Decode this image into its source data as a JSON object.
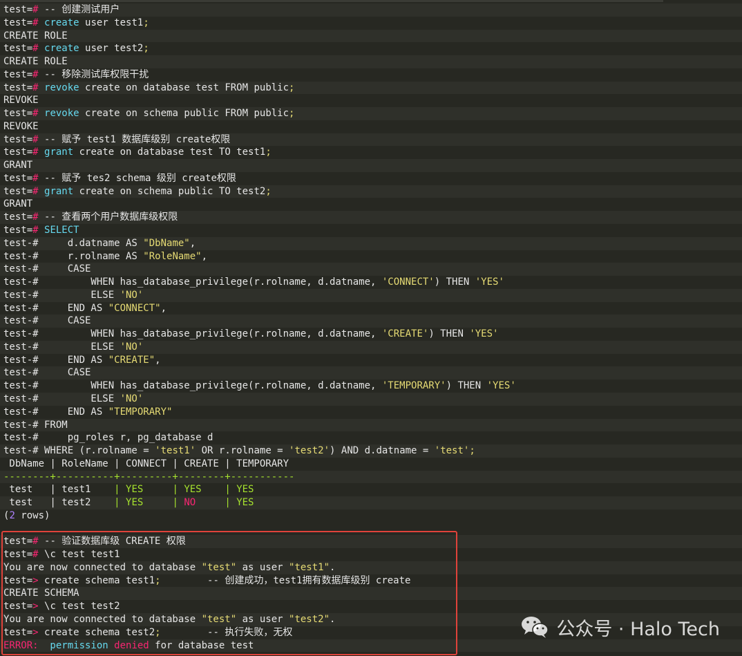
{
  "colors": {
    "background": "#272822",
    "text": "#e6e6e6",
    "prompt": "#e6e6e6",
    "hash": "#f92672",
    "keyword": "#66d9ef",
    "string": "#e6db74",
    "yes": "#a6e22e",
    "no": "#f92672",
    "separator": "#a6e22e",
    "rows_count": "#ae81ff",
    "error": "#f92672",
    "highlight_border": "#e0433b"
  },
  "lines": [
    {
      "stripe": true,
      "segs": [
        {
          "t": "test=",
          "c": "prompt"
        },
        {
          "t": "#",
          "c": "hash"
        },
        {
          "t": " -- 创建测试用户",
          "c": "text"
        }
      ]
    },
    {
      "stripe": false,
      "segs": [
        {
          "t": "test=",
          "c": "prompt"
        },
        {
          "t": "#",
          "c": "hash"
        },
        {
          "t": " create",
          "c": "keyword"
        },
        {
          "t": " user test1",
          "c": "text"
        },
        {
          "t": ";",
          "c": "string"
        }
      ]
    },
    {
      "stripe": true,
      "segs": [
        {
          "t": "CREATE ROLE",
          "c": "text"
        }
      ]
    },
    {
      "stripe": false,
      "segs": [
        {
          "t": "test=",
          "c": "prompt"
        },
        {
          "t": "#",
          "c": "hash"
        },
        {
          "t": " create",
          "c": "keyword"
        },
        {
          "t": " user test2",
          "c": "text"
        },
        {
          "t": ";",
          "c": "string"
        }
      ]
    },
    {
      "stripe": true,
      "segs": [
        {
          "t": "CREATE ROLE",
          "c": "text"
        }
      ]
    },
    {
      "stripe": false,
      "segs": [
        {
          "t": "test=",
          "c": "prompt"
        },
        {
          "t": "#",
          "c": "hash"
        },
        {
          "t": " -- 移除测试库权限干扰",
          "c": "text"
        }
      ]
    },
    {
      "stripe": true,
      "segs": [
        {
          "t": "test=",
          "c": "prompt"
        },
        {
          "t": "#",
          "c": "hash"
        },
        {
          "t": " revoke",
          "c": "keyword"
        },
        {
          "t": " create on database test FROM public",
          "c": "text"
        },
        {
          "t": ";",
          "c": "string"
        }
      ]
    },
    {
      "stripe": false,
      "segs": [
        {
          "t": "REVOKE",
          "c": "text"
        }
      ]
    },
    {
      "stripe": true,
      "segs": [
        {
          "t": "test=",
          "c": "prompt"
        },
        {
          "t": "#",
          "c": "hash"
        },
        {
          "t": " revoke",
          "c": "keyword"
        },
        {
          "t": " create on schema public FROM public",
          "c": "text"
        },
        {
          "t": ";",
          "c": "string"
        }
      ]
    },
    {
      "stripe": false,
      "segs": [
        {
          "t": "REVOKE",
          "c": "text"
        }
      ]
    },
    {
      "stripe": true,
      "segs": [
        {
          "t": "test=",
          "c": "prompt"
        },
        {
          "t": "#",
          "c": "hash"
        },
        {
          "t": " -- 赋予 test1 数据库级别 create权限",
          "c": "text"
        }
      ]
    },
    {
      "stripe": false,
      "segs": [
        {
          "t": "test=",
          "c": "prompt"
        },
        {
          "t": "#",
          "c": "hash"
        },
        {
          "t": " grant",
          "c": "keyword"
        },
        {
          "t": " create on database test TO test1",
          "c": "text"
        },
        {
          "t": ";",
          "c": "string"
        }
      ]
    },
    {
      "stripe": true,
      "segs": [
        {
          "t": "GRANT",
          "c": "text"
        }
      ]
    },
    {
      "stripe": false,
      "segs": [
        {
          "t": "test=",
          "c": "prompt"
        },
        {
          "t": "#",
          "c": "hash"
        },
        {
          "t": " -- 赋予 tes2 schema 级别 create权限",
          "c": "text"
        }
      ]
    },
    {
      "stripe": true,
      "segs": [
        {
          "t": "test=",
          "c": "prompt"
        },
        {
          "t": "#",
          "c": "hash"
        },
        {
          "t": " grant",
          "c": "keyword"
        },
        {
          "t": " create on schema public TO test2",
          "c": "text"
        },
        {
          "t": ";",
          "c": "string"
        }
      ]
    },
    {
      "stripe": false,
      "segs": [
        {
          "t": "GRANT",
          "c": "text"
        }
      ]
    },
    {
      "stripe": true,
      "segs": [
        {
          "t": "test=",
          "c": "prompt"
        },
        {
          "t": "#",
          "c": "hash"
        },
        {
          "t": " -- 查看两个用户数据库级权限",
          "c": "text"
        }
      ]
    },
    {
      "stripe": false,
      "segs": [
        {
          "t": "test=",
          "c": "prompt"
        },
        {
          "t": "#",
          "c": "hash"
        },
        {
          "t": " SELECT",
          "c": "keyword"
        }
      ]
    },
    {
      "stripe": true,
      "segs": [
        {
          "t": "test-#     d.datname AS ",
          "c": "text"
        },
        {
          "t": "\"DbName\"",
          "c": "string"
        },
        {
          "t": ",",
          "c": "text"
        }
      ]
    },
    {
      "stripe": false,
      "segs": [
        {
          "t": "test-#     r.rolname AS ",
          "c": "text"
        },
        {
          "t": "\"RoleName\"",
          "c": "string"
        },
        {
          "t": ",",
          "c": "text"
        }
      ]
    },
    {
      "stripe": true,
      "segs": [
        {
          "t": "test-#     CASE",
          "c": "text"
        }
      ]
    },
    {
      "stripe": false,
      "segs": [
        {
          "t": "test-#         WHEN has_database_privilege(r.rolname, d.datname, ",
          "c": "text"
        },
        {
          "t": "'CONNECT'",
          "c": "string"
        },
        {
          "t": ") THEN ",
          "c": "text"
        },
        {
          "t": "'YES'",
          "c": "string"
        }
      ]
    },
    {
      "stripe": true,
      "segs": [
        {
          "t": "test-#         ELSE ",
          "c": "text"
        },
        {
          "t": "'NO'",
          "c": "string"
        }
      ]
    },
    {
      "stripe": false,
      "segs": [
        {
          "t": "test-#     END AS ",
          "c": "text"
        },
        {
          "t": "\"CONNECT\"",
          "c": "string"
        },
        {
          "t": ",",
          "c": "text"
        }
      ]
    },
    {
      "stripe": true,
      "segs": [
        {
          "t": "test-#     CASE",
          "c": "text"
        }
      ]
    },
    {
      "stripe": false,
      "segs": [
        {
          "t": "test-#         WHEN has_database_privilege(r.rolname, d.datname, ",
          "c": "text"
        },
        {
          "t": "'CREATE'",
          "c": "string"
        },
        {
          "t": ") THEN ",
          "c": "text"
        },
        {
          "t": "'YES'",
          "c": "string"
        }
      ]
    },
    {
      "stripe": true,
      "segs": [
        {
          "t": "test-#         ELSE ",
          "c": "text"
        },
        {
          "t": "'NO'",
          "c": "string"
        }
      ]
    },
    {
      "stripe": false,
      "segs": [
        {
          "t": "test-#     END AS ",
          "c": "text"
        },
        {
          "t": "\"CREATE\"",
          "c": "string"
        },
        {
          "t": ",",
          "c": "text"
        }
      ]
    },
    {
      "stripe": true,
      "segs": [
        {
          "t": "test-#     CASE",
          "c": "text"
        }
      ]
    },
    {
      "stripe": false,
      "segs": [
        {
          "t": "test-#         WHEN has_database_privilege(r.rolname, d.datname, ",
          "c": "text"
        },
        {
          "t": "'TEMPORARY'",
          "c": "string"
        },
        {
          "t": ") THEN ",
          "c": "text"
        },
        {
          "t": "'YES'",
          "c": "string"
        }
      ]
    },
    {
      "stripe": true,
      "segs": [
        {
          "t": "test-#         ELSE ",
          "c": "text"
        },
        {
          "t": "'NO'",
          "c": "string"
        }
      ]
    },
    {
      "stripe": false,
      "segs": [
        {
          "t": "test-#     END AS ",
          "c": "text"
        },
        {
          "t": "\"TEMPORARY\"",
          "c": "string"
        }
      ]
    },
    {
      "stripe": true,
      "segs": [
        {
          "t": "test-# FROM",
          "c": "text"
        }
      ]
    },
    {
      "stripe": false,
      "segs": [
        {
          "t": "test-#     pg_roles r, pg_database d",
          "c": "text"
        }
      ]
    },
    {
      "stripe": true,
      "segs": [
        {
          "t": "test-# WHERE (r.rolname = ",
          "c": "text"
        },
        {
          "t": "'test1'",
          "c": "string"
        },
        {
          "t": " OR r.rolname = ",
          "c": "text"
        },
        {
          "t": "'test2'",
          "c": "string"
        },
        {
          "t": ") AND d.datname = ",
          "c": "text"
        },
        {
          "t": "'test'",
          "c": "string"
        },
        {
          "t": ";",
          "c": "string"
        }
      ]
    },
    {
      "stripe": false,
      "segs": [
        {
          "t": " DbName | RoleName | CONNECT | CREATE | TEMPORARY",
          "c": "text"
        }
      ]
    },
    {
      "stripe": true,
      "segs": [
        {
          "t": "--------+----------+---------+--------+-----------",
          "c": "separator"
        }
      ]
    },
    {
      "stripe": false,
      "segs": [
        {
          "t": " test   | test1    ",
          "c": "text"
        },
        {
          "t": "| ",
          "c": "separator"
        },
        {
          "t": "YES     ",
          "c": "yes"
        },
        {
          "t": "| ",
          "c": "separator"
        },
        {
          "t": "YES    ",
          "c": "yes"
        },
        {
          "t": "| ",
          "c": "separator"
        },
        {
          "t": "YES",
          "c": "yes"
        }
      ]
    },
    {
      "stripe": true,
      "segs": [
        {
          "t": " test   | test2    ",
          "c": "text"
        },
        {
          "t": "| ",
          "c": "separator"
        },
        {
          "t": "YES     ",
          "c": "yes"
        },
        {
          "t": "| ",
          "c": "separator"
        },
        {
          "t": "NO     ",
          "c": "no"
        },
        {
          "t": "| ",
          "c": "separator"
        },
        {
          "t": "YES",
          "c": "yes"
        }
      ]
    },
    {
      "stripe": false,
      "segs": [
        {
          "t": "(",
          "c": "text"
        },
        {
          "t": "2",
          "c": "rows_count"
        },
        {
          "t": " rows)",
          "c": "text"
        }
      ]
    },
    {
      "stripe": false,
      "segs": [
        {
          "t": "",
          "c": "text"
        }
      ]
    },
    {
      "stripe": true,
      "segs": [
        {
          "t": "test=",
          "c": "prompt"
        },
        {
          "t": "#",
          "c": "hash"
        },
        {
          "t": " -- 验证数据库级 CREATE 权限",
          "c": "text"
        }
      ]
    },
    {
      "stripe": false,
      "segs": [
        {
          "t": "test=",
          "c": "prompt"
        },
        {
          "t": "#",
          "c": "hash"
        },
        {
          "t": " \\c test test1",
          "c": "text"
        }
      ]
    },
    {
      "stripe": true,
      "segs": [
        {
          "t": "You are now connected to database ",
          "c": "text"
        },
        {
          "t": "\"test\"",
          "c": "string"
        },
        {
          "t": " as user ",
          "c": "text"
        },
        {
          "t": "\"test1\"",
          "c": "string"
        },
        {
          "t": ".",
          "c": "text"
        }
      ]
    },
    {
      "stripe": false,
      "segs": [
        {
          "t": "test=",
          "c": "prompt"
        },
        {
          "t": ">",
          "c": "hash"
        },
        {
          "t": " create schema test1",
          "c": "text"
        },
        {
          "t": ";",
          "c": "string"
        },
        {
          "t": "        -- 创建成功，test1拥有数据库级别 create",
          "c": "text"
        }
      ]
    },
    {
      "stripe": true,
      "segs": [
        {
          "t": "CREATE SCHEMA",
          "c": "text"
        }
      ]
    },
    {
      "stripe": false,
      "segs": [
        {
          "t": "test=",
          "c": "prompt"
        },
        {
          "t": ">",
          "c": "hash"
        },
        {
          "t": " \\c test test2",
          "c": "text"
        }
      ]
    },
    {
      "stripe": true,
      "segs": [
        {
          "t": "You are now connected to database ",
          "c": "text"
        },
        {
          "t": "\"test\"",
          "c": "string"
        },
        {
          "t": " as user ",
          "c": "text"
        },
        {
          "t": "\"test2\"",
          "c": "string"
        },
        {
          "t": ".",
          "c": "text"
        }
      ]
    },
    {
      "stripe": false,
      "segs": [
        {
          "t": "test=",
          "c": "prompt"
        },
        {
          "t": ">",
          "c": "hash"
        },
        {
          "t": " create schema test2",
          "c": "text"
        },
        {
          "t": ";",
          "c": "string"
        },
        {
          "t": "        -- 执行失败，无权",
          "c": "text"
        }
      ]
    },
    {
      "stripe": true,
      "segs": [
        {
          "t": "ERROR:",
          "c": "error"
        },
        {
          "t": "  permission ",
          "c": "keyword"
        },
        {
          "t": "denied",
          "c": "error"
        },
        {
          "t": " for database test",
          "c": "text"
        }
      ]
    }
  ],
  "watermark": {
    "icon": "wechat-icon",
    "text": "公众号 · Halo Tech"
  }
}
